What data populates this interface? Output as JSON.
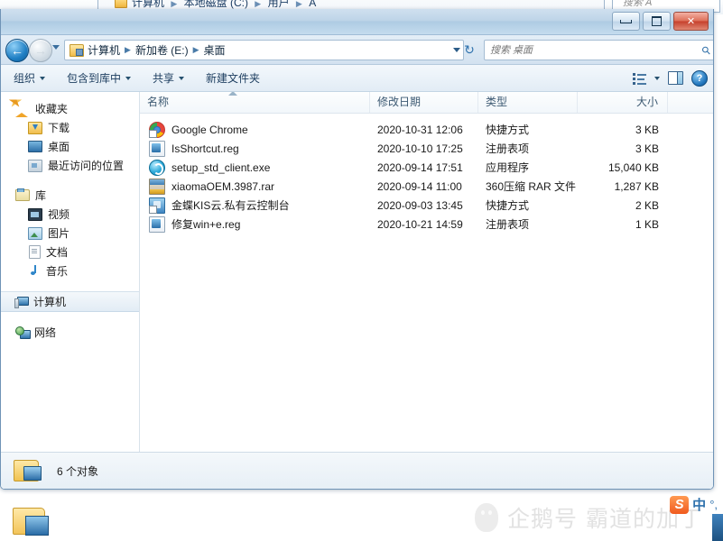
{
  "background_window": {
    "breadcrumb": [
      "计算机",
      "本地磁盘 (C:)",
      "用户",
      "A"
    ],
    "search_placeholder": "搜索 A"
  },
  "window": {
    "controls": {
      "minimize_label": "最小化",
      "maximize_label": "最大化",
      "close_label": "关闭"
    }
  },
  "address_bar": {
    "back_label": "后退",
    "forward_label": "前进",
    "breadcrumb": [
      "计算机",
      "新加卷 (E:)",
      "桌面"
    ],
    "refresh_label": "刷新"
  },
  "search": {
    "placeholder": "搜索 桌面",
    "value": ""
  },
  "toolbar": {
    "items": [
      {
        "label": "组织",
        "caret": true
      },
      {
        "label": "包含到库中",
        "caret": true
      },
      {
        "label": "共享",
        "caret": true
      },
      {
        "label": "新建文件夹",
        "caret": false
      }
    ],
    "view_label": "更改您的视图",
    "preview_label": "显示预览窗格",
    "help_label": "获取帮助",
    "help_glyph": "?"
  },
  "sidebar": {
    "groups": [
      {
        "header": {
          "label": "收藏夹",
          "icon": "star-icon"
        },
        "items": [
          {
            "label": "下载",
            "icon": "downloads-icon"
          },
          {
            "label": "桌面",
            "icon": "desktop-icon"
          },
          {
            "label": "最近访问的位置",
            "icon": "recent-places-icon"
          }
        ]
      },
      {
        "header": {
          "label": "库",
          "icon": "library-icon"
        },
        "items": [
          {
            "label": "视频",
            "icon": "videos-icon"
          },
          {
            "label": "图片",
            "icon": "pictures-icon"
          },
          {
            "label": "文档",
            "icon": "documents-icon"
          },
          {
            "label": "音乐",
            "icon": "music-icon"
          }
        ]
      },
      {
        "header": {
          "label": "计算机",
          "icon": "computer-icon",
          "selected": true
        },
        "items": []
      },
      {
        "header": {
          "label": "网络",
          "icon": "network-icon"
        },
        "items": []
      }
    ]
  },
  "file_list": {
    "columns": [
      {
        "key": "name",
        "label": "名称",
        "sorted": "asc"
      },
      {
        "key": "date",
        "label": "修改日期"
      },
      {
        "key": "type",
        "label": "类型"
      },
      {
        "key": "size",
        "label": "大小"
      }
    ],
    "rows": [
      {
        "name": "Google Chrome",
        "date": "2020-10-31 12:06",
        "type": "快捷方式",
        "size": "3 KB",
        "icon": "chrome-shortcut-icon"
      },
      {
        "name": "IsShortcut.reg",
        "date": "2020-10-10 17:25",
        "type": "注册表项",
        "size": "3 KB",
        "icon": "registry-file-icon"
      },
      {
        "name": "setup_std_client.exe",
        "date": "2020-09-14 17:51",
        "type": "应用程序",
        "size": "15,040 KB",
        "icon": "application-icon"
      },
      {
        "name": "xiaomaOEM.3987.rar",
        "date": "2020-09-14 11:00",
        "type": "360压缩 RAR 文件",
        "size": "1,287 KB",
        "icon": "rar-archive-icon"
      },
      {
        "name": "金蝶KIS云.私有云控制台",
        "date": "2020-09-03 13:45",
        "type": "快捷方式",
        "size": "2 KB",
        "icon": "kingdee-shortcut-icon"
      },
      {
        "name": "修复win+e.reg",
        "date": "2020-10-21 14:59",
        "type": "注册表项",
        "size": "1 KB",
        "icon": "registry-file-icon"
      }
    ]
  },
  "status_bar": {
    "text": "6 个对象",
    "icon": "folder-computer-icon"
  },
  "watermark": {
    "text": "企鹅号 霸道的加丁",
    "icon": "qq-penguin-icon"
  },
  "ime": {
    "logo": "S",
    "mode": "中",
    "punctuation": "°,"
  },
  "colors": {
    "accent": "#2f72ad",
    "title_bar": "#bed4e8",
    "close_button": "#c6402c",
    "selected_row": "#e2ecf5"
  }
}
